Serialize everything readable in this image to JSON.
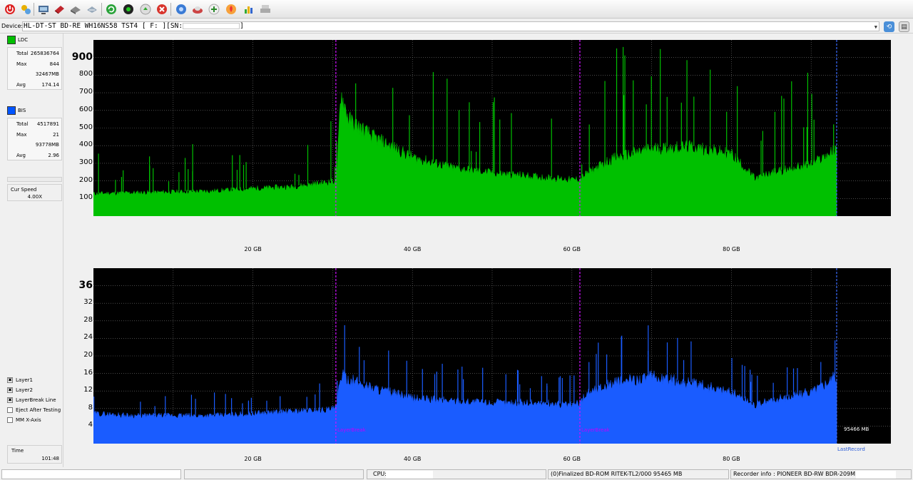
{
  "toolbar": {
    "buttons": [
      "power-icon",
      "connect-icon",
      "drive-info-icon",
      "erase-icon",
      "disc-icon",
      "scan-icon",
      "refresh-icon",
      "start-icon",
      "eject-icon",
      "stop-icon",
      "settings-icon",
      "disc-read-icon",
      "disc-write-icon",
      "burn-icon",
      "chart-icon",
      "print-icon"
    ]
  },
  "device": {
    "label": "Device:",
    "value": "HL-DT-ST BD-RE  WH16NS58  TST4 [ F: ][SN:",
    "value_end": "]"
  },
  "ldc": {
    "label": "LDC",
    "color": "#00bf00",
    "stats": [
      {
        "key": "Total",
        "value": "265836764"
      },
      {
        "key": "Max",
        "value": "844"
      },
      {
        "key": "",
        "value": "32467MB"
      },
      {
        "key": "Avg",
        "value": "174.14"
      }
    ]
  },
  "bis": {
    "label": "BIS",
    "color": "#0055ff",
    "stats": [
      {
        "key": "Total",
        "value": "4517891"
      },
      {
        "key": "Max",
        "value": "21"
      },
      {
        "key": "",
        "value": "93778MB"
      },
      {
        "key": "Avg",
        "value": "2.96"
      }
    ]
  },
  "cur_speed": {
    "label": "Cur Speed",
    "value": "4.00X"
  },
  "options": [
    {
      "label": "Layer1",
      "checked": true
    },
    {
      "label": "Layer2",
      "checked": true
    },
    {
      "label": "LayerBreak Line",
      "checked": true
    },
    {
      "label": "Eject After Testing",
      "checked": false
    },
    {
      "label": "MM X-Axis",
      "checked": false
    }
  ],
  "time": {
    "label": "Time",
    "value": "101:48"
  },
  "chart_data": [
    {
      "type": "area",
      "series_label": "LDC",
      "x_unit": "GB",
      "xlim": [
        0,
        100
      ],
      "ylim": [
        0,
        1000
      ],
      "y_ticks": [
        "900",
        "800",
        "700",
        "600",
        "500",
        "400",
        "300",
        "200",
        "100"
      ],
      "x_ticks": [
        "20 GB",
        "40 GB",
        "60 GB",
        "80 GB"
      ],
      "x": [
        0,
        5,
        10,
        15,
        20,
        25,
        30,
        30.5,
        31,
        32,
        35,
        40,
        45,
        50,
        55,
        60,
        61,
        62,
        65,
        70,
        75,
        80,
        83,
        85,
        90,
        93
      ],
      "y": [
        130,
        135,
        140,
        145,
        160,
        170,
        200,
        210,
        720,
        560,
        460,
        340,
        280,
        250,
        230,
        210,
        215,
        250,
        330,
        390,
        400,
        360,
        215,
        250,
        300,
        380
      ],
      "layer_break_gb": [
        30.4,
        61
      ],
      "last_record_gb": 93.2,
      "grid": true
    },
    {
      "type": "area",
      "series_label": "BIS",
      "x_unit": "GB",
      "xlim": [
        0,
        100
      ],
      "ylim": [
        0,
        40
      ],
      "y_ticks": [
        "36",
        "32",
        "28",
        "24",
        "20",
        "16",
        "12",
        "8",
        "4"
      ],
      "x_ticks": [
        "20 GB",
        "40 GB",
        "60 GB",
        "80 GB"
      ],
      "x": [
        0,
        5,
        10,
        15,
        20,
        25,
        30,
        30.5,
        31,
        32,
        35,
        40,
        45,
        50,
        55,
        60,
        61,
        62,
        65,
        70,
        75,
        80,
        83,
        85,
        90,
        93
      ],
      "y": [
        7,
        6.5,
        6.5,
        6.5,
        7,
        7.5,
        8,
        8.5,
        16,
        15,
        13,
        10.5,
        10,
        9.5,
        9.5,
        9,
        9.5,
        12,
        14,
        15.5,
        14,
        12,
        9,
        10,
        12,
        15.5
      ],
      "layer_break_gb": [
        30.4,
        61
      ],
      "last_record_gb": 93.2,
      "grid": true,
      "layerbreak_label": "LayerBreak",
      "size_label": "95466 MB",
      "last_record_label": "LastRecord"
    }
  ],
  "status": {
    "cpu_label": "CPU:",
    "disc": "(0)Finalized  BD-ROM  RITEK-TL2/000  95465 MB",
    "recorder": "Recorder info : PIONEER      BD-RW   BDR-209M"
  }
}
